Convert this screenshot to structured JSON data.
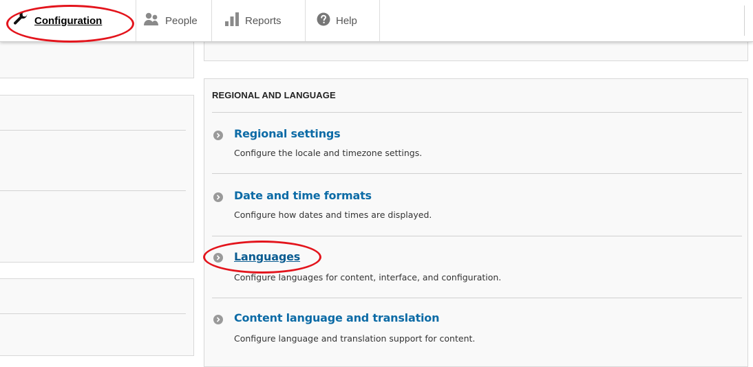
{
  "toolbar": {
    "tabs": [
      {
        "label": "Configuration",
        "icon": "wrench-icon",
        "active": true
      },
      {
        "label": "People",
        "icon": "people-icon"
      },
      {
        "label": "Reports",
        "icon": "bar-chart-icon"
      },
      {
        "label": "Help",
        "icon": "help-icon"
      }
    ]
  },
  "section": {
    "title": "REGIONAL AND LANGUAGE",
    "items": [
      {
        "title": "Regional settings",
        "description": "Configure the locale and timezone settings."
      },
      {
        "title": "Date and time formats",
        "description": "Configure how dates and times are displayed."
      },
      {
        "title": "Languages",
        "description": "Configure languages for content, interface, and configuration."
      },
      {
        "title": "Content language and translation",
        "description": "Configure language and translation support for content."
      }
    ]
  },
  "colors": {
    "link": "#0c6ba6",
    "annotation": "#e3141c",
    "panel_bg": "#f9f9f9"
  }
}
